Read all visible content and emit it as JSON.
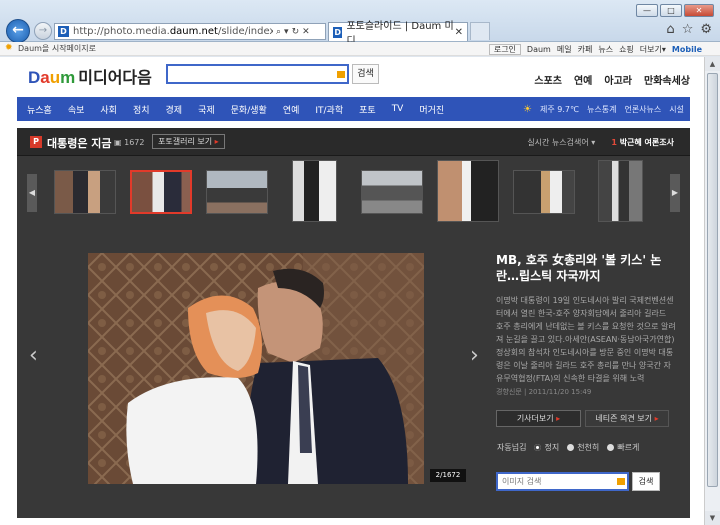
{
  "browser": {
    "url_prefix": "http://photo.media.",
    "url_domain": "daum.net",
    "url_suffix": "/slide/index.html?photoid=",
    "tab_title": "포토슬라이드 | Daum 미디...",
    "favorites_text": "Daum을 시작페이지로",
    "window_buttons": [
      "—",
      "□",
      "✕"
    ]
  },
  "header": {
    "utility_links": [
      "로그인",
      "Daum",
      "메일",
      "카페",
      "뉴스",
      "쇼핑",
      "더보기▾",
      "Mobile"
    ],
    "logo_text": "Daum",
    "site_title": "미디어다음",
    "search_button": "검색",
    "service_menu": [
      "스포츠",
      "연예",
      "아고라",
      "만화속세상"
    ]
  },
  "gnb": {
    "items": [
      "뉴스홈",
      "속보",
      "사회",
      "정치",
      "경제",
      "국제",
      "문화/생활",
      "연예",
      "IT/과학",
      "포토",
      "TV",
      "머거진"
    ],
    "weather": "제주 9.7℃",
    "right_links": [
      "뉴스통계",
      "언론사뉴스",
      "시설"
    ]
  },
  "viewer": {
    "section_title": "대통령은 지금",
    "photo_count": "1672",
    "gallery_button": "포토갤러리 보기",
    "realtime_label": "실시간 뉴스검색어",
    "rank_label": "박근혜 여론조사",
    "rank_num": "1",
    "counter": "2/1672",
    "article": {
      "headline": "MB, 호주 女총리와 '볼 키스' 논란…립스틱 자국까지",
      "body": "이명박 대통령이 19일 인도네시아 발리 국제컨벤션센터에서 열린 한국-호주 양자회담에서 줄리아 길라드 호주 총리에게 난데없는 볼 키스를 요청한 것으로 알려져 눈길을 끌고 있다.아세안(ASEAN·동남아국가연합) 정상회의 참석차 인도네시아를 방문 중인 이명박 대통령은 이날 줄리아 길라드 호주 총리를 만나 양국간 자유무역협정(FTA)의 신속한 타결을 위해 노력",
      "source": "경향신문 | 2011/11/20 15:49"
    },
    "buttons": [
      "기사더보기",
      "네티즌 의견 보기"
    ],
    "autoplay_label": "자동넘김",
    "autoplay_options": [
      "정지",
      "천천히",
      "빠르게"
    ],
    "image_search_placeholder": "이미지 검색",
    "image_search_button": "검색"
  },
  "colors": {
    "accent_blue": "#2f54b8",
    "viewer_bg": "#383838",
    "highlight_red": "#e23a2a"
  }
}
